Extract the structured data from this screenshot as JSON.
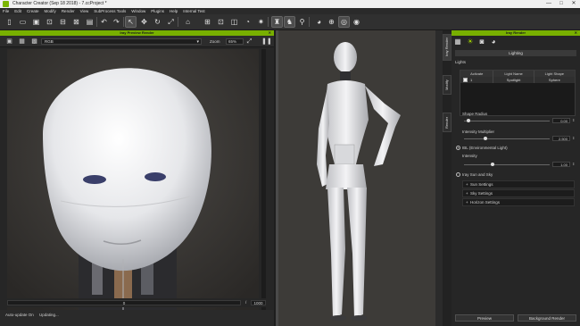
{
  "window": {
    "title": "Character Creator (Sep 18 2018) - 7.ccProject *",
    "minimize": "—",
    "maximize": "□",
    "close": "✕"
  },
  "menu": [
    "File",
    "Edit",
    "Create",
    "Modify",
    "Render",
    "View",
    "SubProcess Tools",
    "Window",
    "Plugins",
    "Help",
    "Internal Test"
  ],
  "preview_panel": {
    "title": "Iray Preview Render",
    "channel": "RGB",
    "zoom_label": "Zoom",
    "zoom_value": "65%",
    "frame_current": "0",
    "frame_sep": "/",
    "frame_max": "1000",
    "status_autoupdate": "Auto-update On",
    "status_updating": "Updating..."
  },
  "side_tabs": [
    "Iray Render",
    "Modify",
    "Render"
  ],
  "render_panel": {
    "title": "Iray Render",
    "section": "Lighting",
    "lights_label": "Lights",
    "table_headers": [
      "Activate",
      "Light Name",
      "Light Shape"
    ],
    "table_rows": [
      {
        "activate": "1",
        "name": "Spotlight",
        "shape": "Sphere"
      }
    ],
    "shape_radius_label": "Shape Radius",
    "shape_radius_value": "0.00",
    "shape_radius_fraction": 0.05,
    "intensity_multiplier_label": "Intensity Multiplier",
    "intensity_multiplier_value": "2.500",
    "intensity_multiplier_fraction": 0.25,
    "ibl_label": "IBL (Environmental Light)",
    "intensity_label": "Intensity",
    "intensity_value": "1.00",
    "intensity_fraction": 0.33,
    "iray_sun_label": "Iray Sun and Sky",
    "sun_settings": "Sun Settings",
    "sky_settings": "Sky Settings",
    "horizon_settings": "Horizon Settings",
    "preview_button": "Preview",
    "background_render_button": "Background Render"
  },
  "colors": {
    "accent": "#78b000",
    "panel": "#262626",
    "viewport": "#3d3b38"
  }
}
